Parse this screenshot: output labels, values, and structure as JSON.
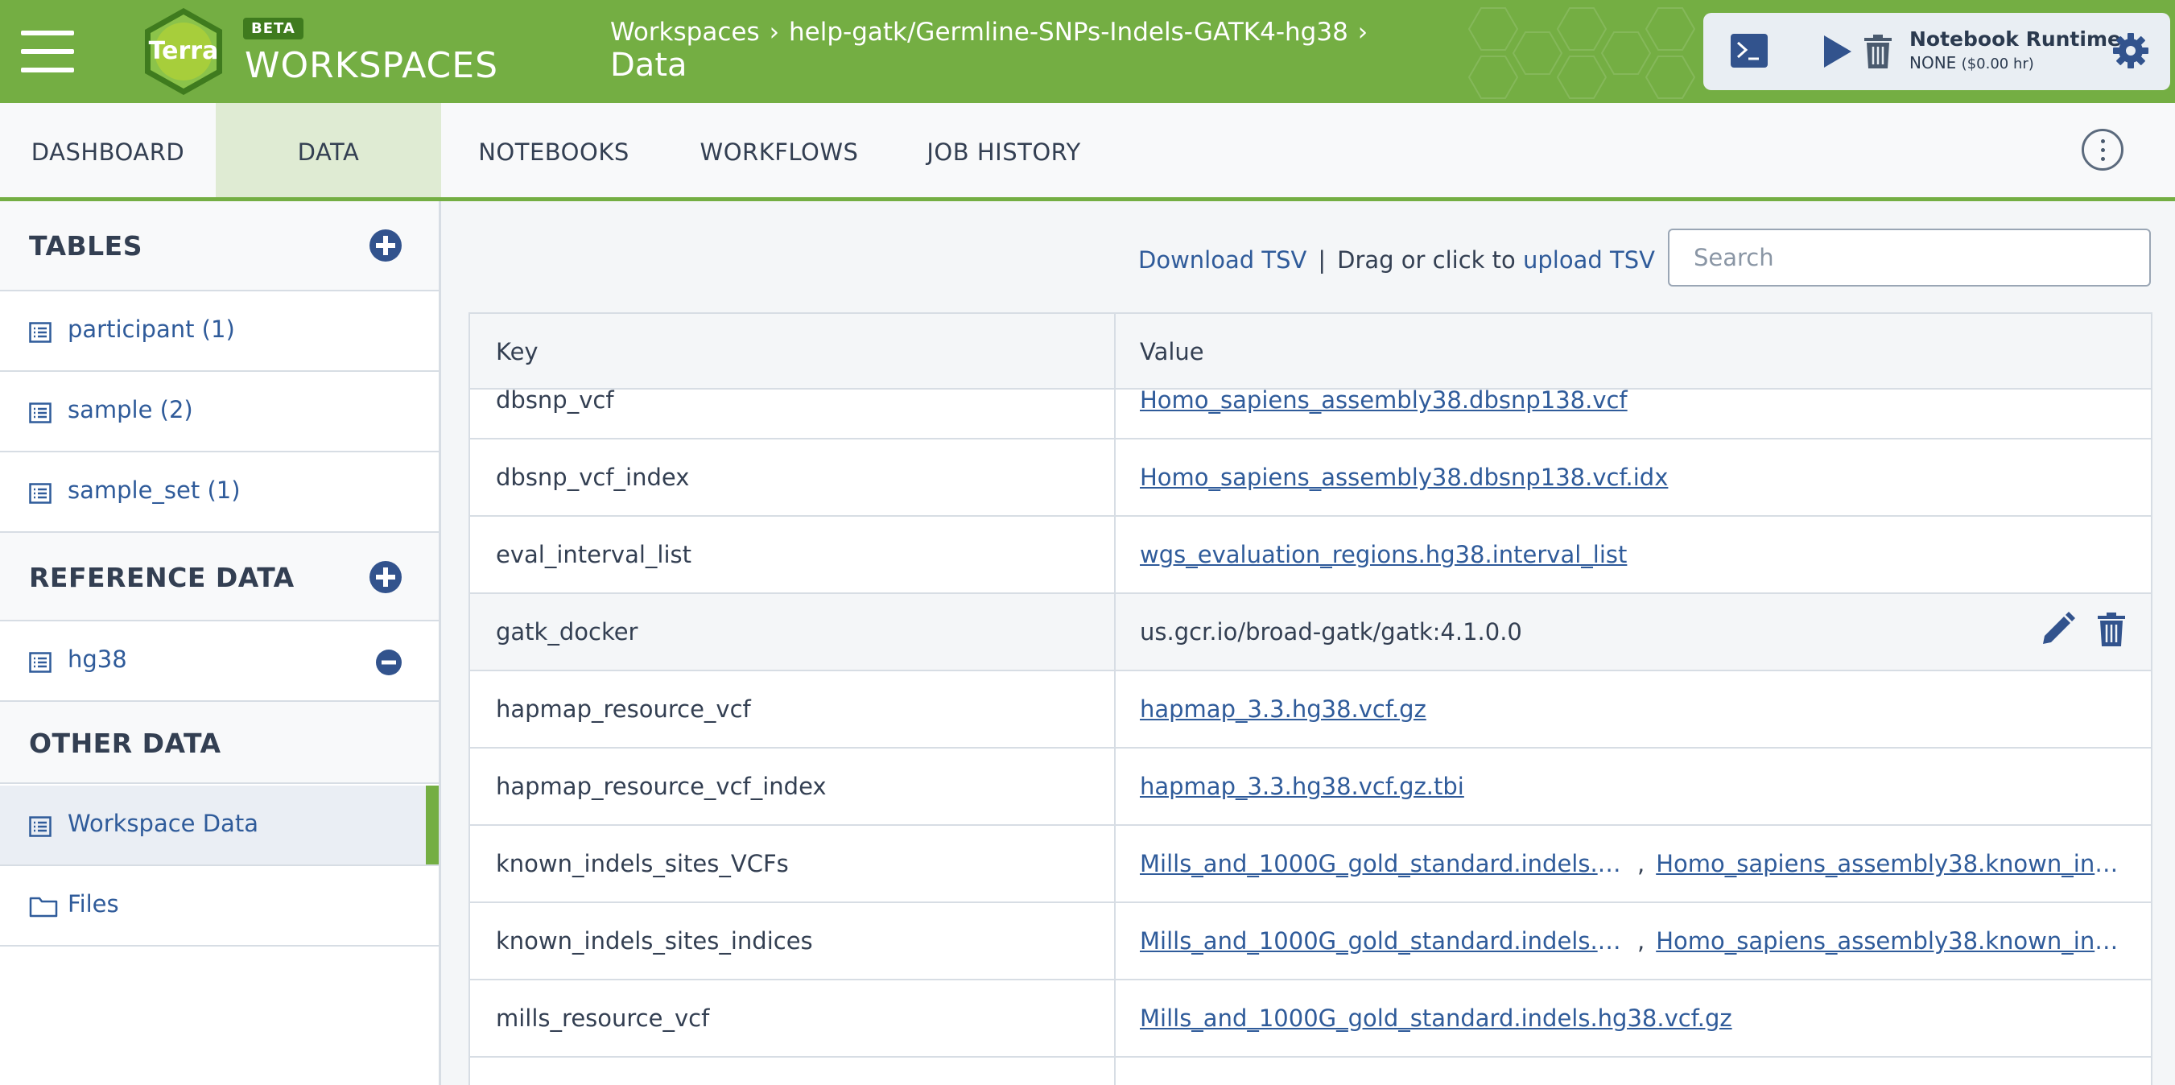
{
  "header": {
    "logo_text": "Terra",
    "beta_label": "BETA",
    "app_title": "WORKSPACES",
    "breadcrumb": [
      "Workspaces",
      "help-gatk/Germline-SNPs-Indels-GATK4-hg38"
    ],
    "breadcrumb_separator": "›",
    "page_title": "Data",
    "brand_color": "#74ae43"
  },
  "runtime": {
    "title": "Notebook Runtime",
    "status": "NONE",
    "cost": "($0.00 hr)"
  },
  "tabs": [
    {
      "label": "DASHBOARD",
      "active": false
    },
    {
      "label": "DATA",
      "active": true
    },
    {
      "label": "NOTEBOOKS",
      "active": false
    },
    {
      "label": "WORKFLOWS",
      "active": false
    },
    {
      "label": "JOB HISTORY",
      "active": false
    }
  ],
  "sidebar": {
    "tables_header": "TABLES",
    "tables": [
      {
        "label": "participant (1)"
      },
      {
        "label": "sample (2)"
      },
      {
        "label": "sample_set (1)"
      }
    ],
    "reference_header": "REFERENCE DATA",
    "reference": [
      {
        "label": "hg38"
      }
    ],
    "other_header": "OTHER DATA",
    "other": [
      {
        "label": "Workspace Data",
        "selected": true
      },
      {
        "label": "Files"
      }
    ]
  },
  "toolbar": {
    "download_label": "Download TSV",
    "separator": "|",
    "drag_text": "Drag or click to",
    "upload_label": "upload TSV",
    "search_placeholder": "Search"
  },
  "table": {
    "columns": [
      "Key",
      "Value"
    ],
    "rows": [
      {
        "key": "dbsnp_vcf",
        "values": [
          "Homo_sapiens_assembly38.dbsnp138.vcf"
        ],
        "link": true
      },
      {
        "key": "dbsnp_vcf_index",
        "values": [
          "Homo_sapiens_assembly38.dbsnp138.vcf.idx"
        ],
        "link": true
      },
      {
        "key": "eval_interval_list",
        "values": [
          "wgs_evaluation_regions.hg38.interval_list"
        ],
        "link": true
      },
      {
        "key": "gatk_docker",
        "values": [
          "us.gcr.io/broad-gatk/gatk:4.1.0.0"
        ],
        "link": false,
        "hover": true
      },
      {
        "key": "hapmap_resource_vcf",
        "values": [
          "hapmap_3.3.hg38.vcf.gz"
        ],
        "link": true
      },
      {
        "key": "hapmap_resource_vcf_index",
        "values": [
          "hapmap_3.3.hg38.vcf.gz.tbi"
        ],
        "link": true
      },
      {
        "key": "known_indels_sites_VCFs",
        "values": [
          "Mills_and_1000G_gold_standard.indels.h…",
          "Homo_sapiens_assembly38.known_ind…"
        ],
        "link": true
      },
      {
        "key": "known_indels_sites_indices",
        "values": [
          "Mills_and_1000G_gold_standard.indels.h…",
          "Homo_sapiens_assembly38.known_ind…"
        ],
        "link": true
      },
      {
        "key": "mills_resource_vcf",
        "values": [
          "Mills_and_1000G_gold_standard.indels.hg38.vcf.gz"
        ],
        "link": true
      },
      {
        "key": "",
        "values": [
          ""
        ],
        "link": false
      }
    ]
  }
}
